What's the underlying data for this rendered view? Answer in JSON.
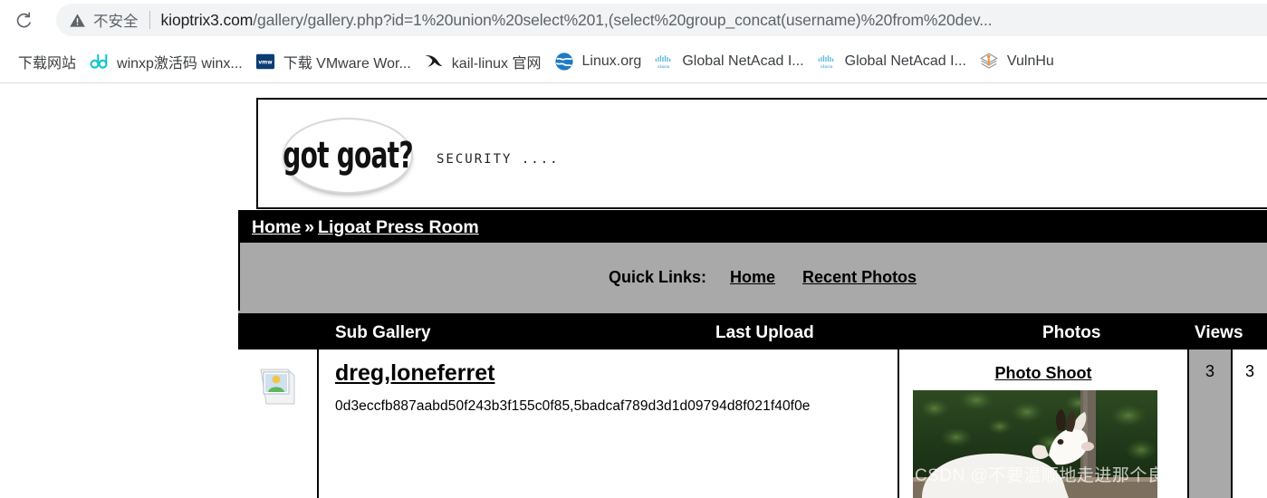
{
  "browser": {
    "reload_icon": "reload-icon",
    "security_icon": "warning-triangle-icon",
    "security_label": "不安全",
    "url_host": "kioptrix3.com",
    "url_path": "/gallery/gallery.php?id=1%20union%20select%201,(select%20group_concat(username)%20from%20dev...",
    "bookmarks": [
      {
        "icon": "generic-site-icon",
        "label": "下载网站"
      },
      {
        "icon": "dd-icon",
        "label": "winxp激活码 winx..."
      },
      {
        "icon": "vmware-icon",
        "label": "下载 VMware Wor..."
      },
      {
        "icon": "kali-dragon-icon",
        "label": "kail-linux 官网"
      },
      {
        "icon": "globe-icon",
        "label": "Linux.org"
      },
      {
        "icon": "cisco-icon",
        "label": "Global NetAcad I..."
      },
      {
        "icon": "cisco-icon",
        "label": "Global NetAcad I..."
      },
      {
        "icon": "vulnhub-icon",
        "label": "VulnHu"
      }
    ]
  },
  "site": {
    "logo_text": "got goat?",
    "tagline": "SECURITY ....",
    "breadcrumb": {
      "home": "Home",
      "separator": "»",
      "current": "Ligoat Press Room"
    },
    "quick_links": {
      "label": "Quick Links:",
      "items": [
        "Home",
        "Recent Photos"
      ]
    }
  },
  "table": {
    "headers": [
      "Sub Gallery",
      "Last Upload",
      "Photos",
      "Views"
    ],
    "rows": [
      {
        "thumb_icon": "broken-image-icon",
        "title": "dreg,loneferret",
        "subtitle": "0d3eccfb887aabd50f243b3f155c0f85,5badcaf789d3d1d09794d8f021f40f0e",
        "last_upload_link": "Photo Shoot",
        "last_upload_image": "goat-photo",
        "photos": "3",
        "views": "3"
      }
    ]
  },
  "watermark": "CSDN @不要温顺地走进那个良夜",
  "colors": {
    "nav_black": "#000000",
    "band_gray": "#a9a9a9",
    "chrome_gray": "#f1f3f4",
    "text_gray": "#5f6368"
  }
}
